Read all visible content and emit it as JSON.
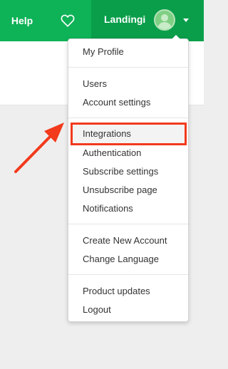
{
  "header": {
    "help_label": "Help",
    "favorites_icon": "heart-icon",
    "username": "Landingi",
    "avatar_icon": "user-avatar",
    "menu_caret_icon": "caret-down-icon"
  },
  "dropdown": {
    "items": [
      {
        "label": "My Profile"
      },
      {
        "label": "Users"
      },
      {
        "label": "Account settings"
      },
      {
        "label": "Integrations"
      },
      {
        "label": "Authentication"
      },
      {
        "label": "Subscribe settings"
      },
      {
        "label": "Unsubscribe page"
      },
      {
        "label": "Notifications"
      },
      {
        "label": "Create New Account"
      },
      {
        "label": "Change Language"
      },
      {
        "label": "Product updates"
      },
      {
        "label": "Logout"
      }
    ]
  },
  "colors": {
    "brand_green": "#0eb257",
    "brand_green_dark": "#0a9e4b",
    "annotation_red": "#f23a1c"
  }
}
